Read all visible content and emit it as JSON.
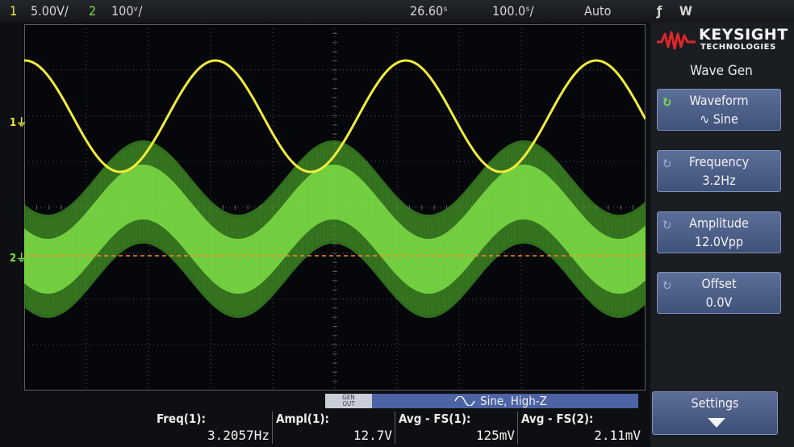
{
  "topbar": {
    "ch1_num": "1",
    "ch1_scale": "5.00V/",
    "ch2_num": "2",
    "ch2_scale": "100ᵛ/",
    "time_scale": "26.60ˢ",
    "time_delay": "100.0ˢ/",
    "trigger_mode": "Auto",
    "trigger_slope_icon": "ƒ",
    "trigger_source": "W"
  },
  "screen": {
    "ch1_marker": "1",
    "ch2_marker": "2",
    "colors": {
      "ch1": "#f3ec3a",
      "ch2": "#7fe046",
      "ref": "#ff8a1e",
      "grid": "#5a5d63"
    }
  },
  "brand": {
    "name": "KEYSIGHT",
    "sub": "TECHNOLOGIES"
  },
  "panel": {
    "title": "Wave Gen",
    "keys": [
      {
        "label": "Waveform",
        "value": "∿ Sine",
        "icon": "rotate-icon"
      },
      {
        "label": "Frequency",
        "value": "3.2Hz",
        "icon": "rotate-icon"
      },
      {
        "label": "Amplitude",
        "value": "12.0Vpp",
        "icon": "rotate-icon"
      },
      {
        "label": "Offset",
        "value": "0.0V",
        "icon": "rotate-icon"
      }
    ],
    "settings": "Settings"
  },
  "genbar": {
    "gen_line1": "GEN",
    "gen_line2": "OUT",
    "text": "Sine, High-Z",
    "icon": "sine-icon"
  },
  "measurements": [
    {
      "label": "Freq(1):",
      "value": "3.2057Hz"
    },
    {
      "label": "Ampl(1):",
      "value": "12.7V"
    },
    {
      "label": "Avg - FS(1):",
      "value": "125mV"
    },
    {
      "label": "Avg - FS(2):",
      "value": "2.11mV"
    }
  ]
}
